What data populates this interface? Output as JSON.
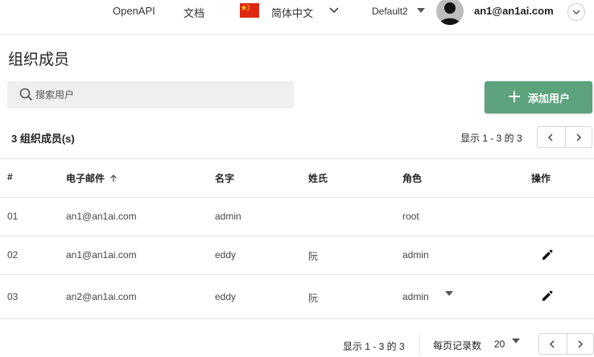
{
  "header": {
    "nav": [
      {
        "label": "OpenAPI"
      },
      {
        "label": "文档"
      }
    ],
    "language": "简体中文",
    "tenant": "Default2",
    "user": "an1@an1ai.com",
    "flag_color": "#de2910"
  },
  "page": {
    "title": "组织成员"
  },
  "search": {
    "placeholder": "搜索用户",
    "value": ""
  },
  "add_button": {
    "label": "添加用户",
    "color": "#5ca27c"
  },
  "summary": {
    "count_label": "3 组织成员(s)",
    "showing": "显示 1 - 3 的 3"
  },
  "table": {
    "headers": [
      "#",
      "电子邮件",
      "名字",
      "姓氏",
      "角色",
      "操作"
    ],
    "rows": [
      {
        "num": "01",
        "email": "an1@an1ai.com",
        "first": "admin",
        "last": "",
        "role": "root"
      },
      {
        "num": "02",
        "email": "an1@an1ai.com",
        "first": "eddy",
        "last": "阮",
        "role": "admin"
      },
      {
        "num": "03",
        "email": "an2@an1ai.com",
        "first": "eddy",
        "last": "阮",
        "role": "admin"
      }
    ]
  },
  "footer": {
    "showing": "显示 1 - 3 的 3",
    "per_page_label": "每页记录数",
    "per_page_value": "20"
  }
}
